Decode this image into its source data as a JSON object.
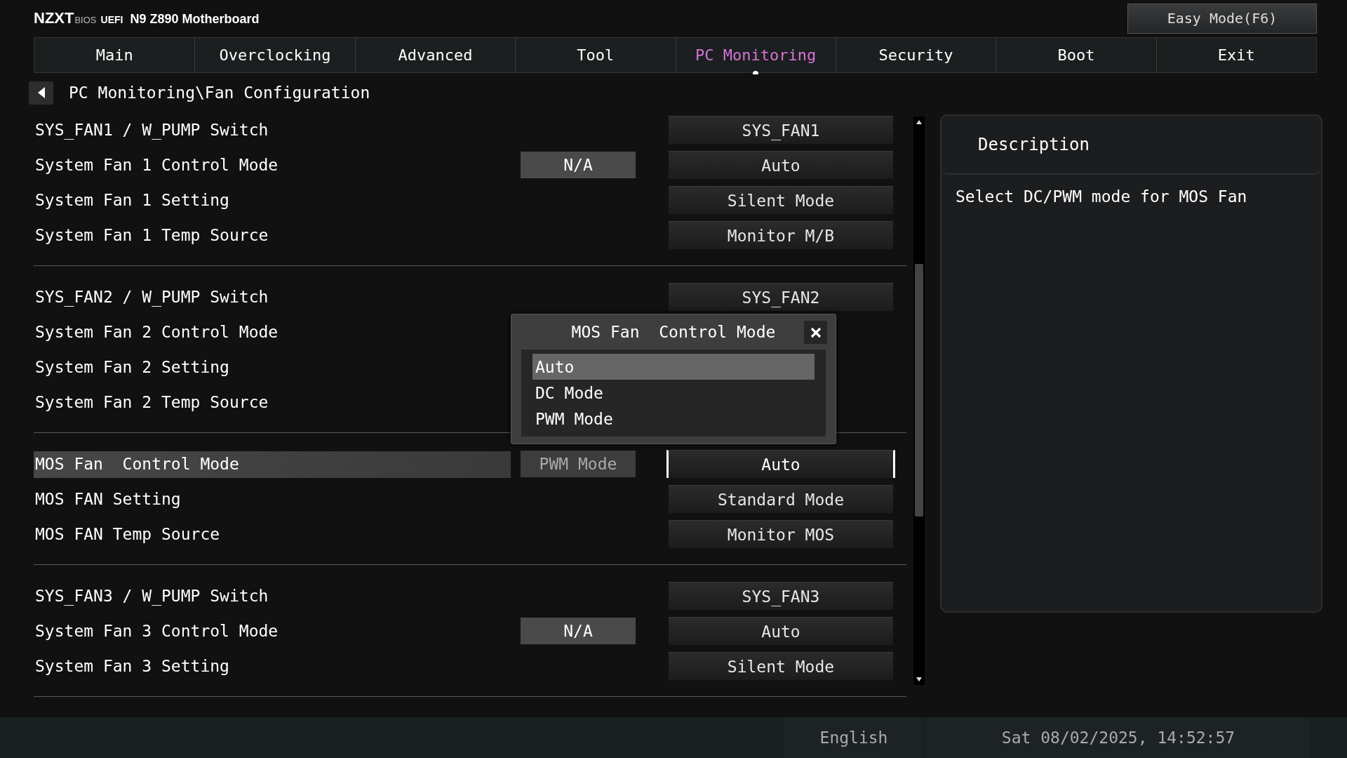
{
  "header": {
    "brand": "NZXT",
    "bios": "BIOS",
    "uefi": "UEFI",
    "model": "N9 Z890 Motherboard",
    "easy_mode": "Easy Mode(F6)"
  },
  "tabs": [
    {
      "label": "Main",
      "selected": false
    },
    {
      "label": "Overclocking",
      "selected": false
    },
    {
      "label": "Advanced",
      "selected": false
    },
    {
      "label": "Tool",
      "selected": false
    },
    {
      "label": "PC Monitoring",
      "selected": true
    },
    {
      "label": "Security",
      "selected": false
    },
    {
      "label": "Boot",
      "selected": false
    },
    {
      "label": "Exit",
      "selected": false
    }
  ],
  "breadcrumb": "PC Monitoring\\Fan Configuration",
  "groups": [
    {
      "rows": [
        {
          "label": "SYS_FAN1 / W_PUMP Switch",
          "value": "SYS_FAN1",
          "selected": false
        },
        {
          "label": "System Fan 1 Control Mode",
          "status": "N/A",
          "value": "Auto",
          "selected": false
        },
        {
          "label": "System Fan 1 Setting",
          "value": "Silent Mode",
          "selected": false
        },
        {
          "label": "System Fan 1 Temp Source",
          "value": "Monitor M/B",
          "selected": false
        }
      ]
    },
    {
      "rows": [
        {
          "label": "SYS_FAN2 / W_PUMP Switch",
          "value": "SYS_FAN2",
          "selected": false
        },
        {
          "label": "System Fan 2 Control Mode",
          "selected": false
        },
        {
          "label": "System Fan 2 Setting",
          "selected": false
        },
        {
          "label": "System Fan 2 Temp Source",
          "selected": false
        }
      ]
    },
    {
      "rows": [
        {
          "label": "MOS Fan  Control Mode",
          "status": "PWM Mode",
          "value": "Auto",
          "selected": true
        },
        {
          "label": "MOS FAN Setting",
          "value": "Standard Mode",
          "selected": false
        },
        {
          "label": "MOS FAN Temp Source",
          "value": "Monitor MOS",
          "selected": false
        }
      ]
    },
    {
      "rows": [
        {
          "label": "SYS_FAN3 / W_PUMP Switch",
          "value": "SYS_FAN3",
          "selected": false
        },
        {
          "label": "System Fan 3 Control Mode",
          "status": "N/A",
          "value": "Auto",
          "selected": false
        },
        {
          "label": "System Fan 3 Setting",
          "value": "Silent Mode",
          "selected": false
        }
      ]
    }
  ],
  "description": {
    "title": "Description",
    "text": "Select DC/PWM mode for MOS Fan"
  },
  "popup": {
    "title": "MOS Fan  Control Mode",
    "options": [
      {
        "label": "Auto",
        "selected": true
      },
      {
        "label": "DC Mode",
        "selected": false
      },
      {
        "label": "PWM Mode",
        "selected": false
      }
    ]
  },
  "status_bar": {
    "language": "English",
    "datetime": "Sat 08/02/2025, 14:52:57"
  }
}
